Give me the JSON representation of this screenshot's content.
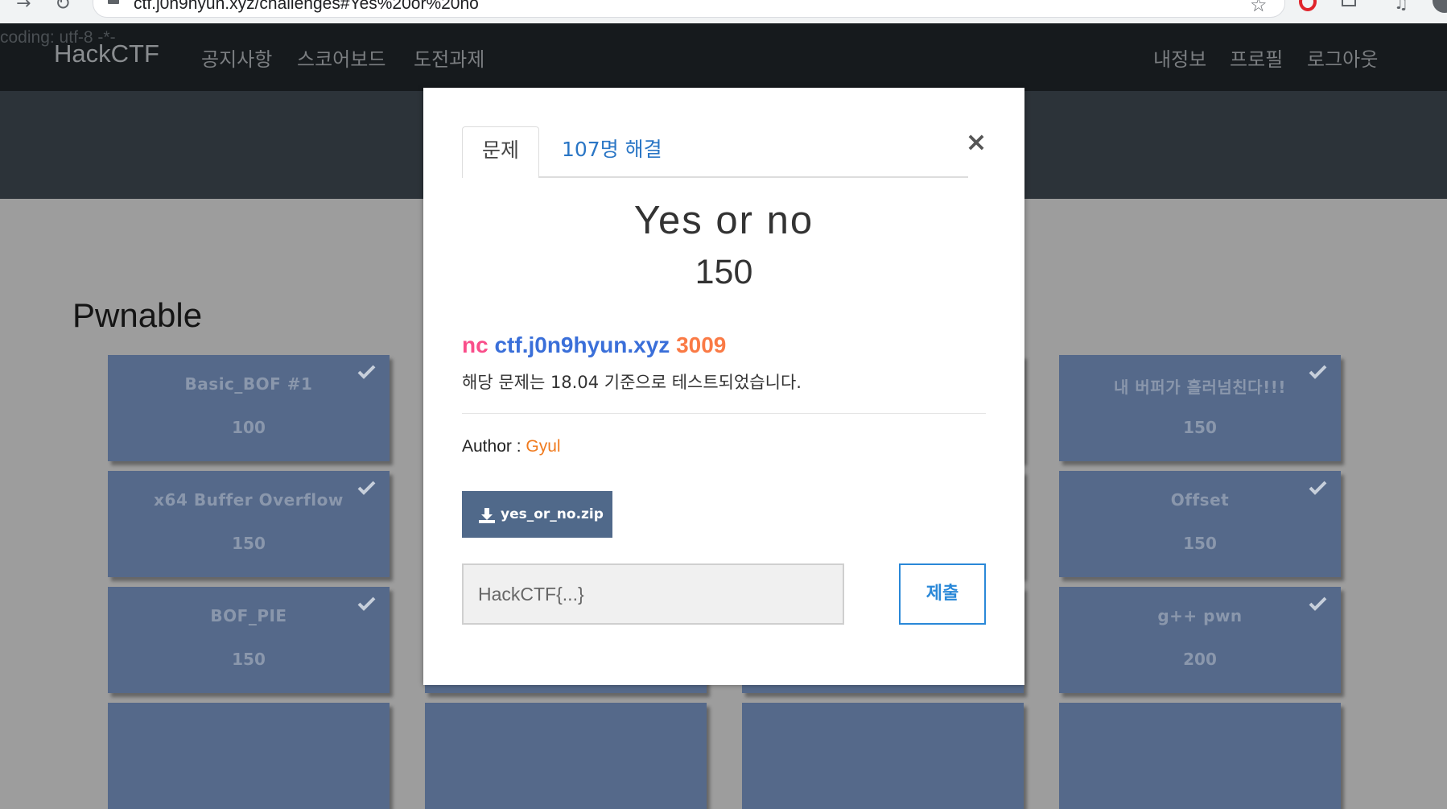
{
  "browser": {
    "url": "ctf.j0n9hyun.xyz/challenges#Yes%20or%20no"
  },
  "site": {
    "coding_text": "coding: utf-8 -*-",
    "brand": "HackCTF",
    "nav_left": [
      "공지사항",
      "스코어보드",
      "도전과제"
    ],
    "nav_right": [
      "내정보",
      "프로필",
      "로그아웃"
    ],
    "category": "Pwnable"
  },
  "cards": [
    {
      "name": "Basic_BOF #1",
      "value": "100",
      "solved": true
    },
    {
      "name": "x64 Buffer Overflow",
      "value": "150",
      "solved": true
    },
    {
      "name": "BOF_PIE",
      "value": "150",
      "solved": true
    },
    {
      "name": "내 버퍼가 흘러넘친다!!!",
      "value": "150",
      "solved": true
    },
    {
      "name": "Offset",
      "value": "150",
      "solved": true
    },
    {
      "name": "g++ pwn",
      "value": "200",
      "solved": true
    }
  ],
  "modal": {
    "tab_challenge": "문제",
    "tab_solves": "107명 해결",
    "close": "×",
    "challenge_name": "Yes or no",
    "challenge_value": "150",
    "conn_nc": "nc",
    "conn_host": "ctf.j0n9hyun.xyz",
    "conn_port": "3009",
    "description": "해당 문제는 18.04 기준으로 테스트되었습니다.",
    "author_label": "Author : ",
    "author_name": "Gyul",
    "download_label": "yes_or_no.zip",
    "flag_placeholder": "HackCTF{...}",
    "submit_label": "제출"
  },
  "colors": {
    "nc": "#f94e8a",
    "host": "#3a6fd9",
    "port": "#fa7a45",
    "author": "#f07b1f"
  }
}
